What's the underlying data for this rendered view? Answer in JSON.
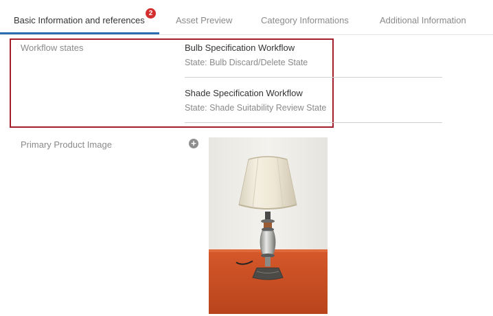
{
  "tabs": [
    {
      "label": "Basic Information and references",
      "active": true,
      "badge": "2"
    },
    {
      "label": "Asset Preview",
      "active": false
    },
    {
      "label": "Category Informations",
      "active": false
    },
    {
      "label": "Additional Information",
      "active": false
    }
  ],
  "workflow_section": {
    "label": "Workflow states",
    "workflows": [
      {
        "title": "Bulb Specification Workflow",
        "state": "State: Bulb Discard/Delete State"
      },
      {
        "title": "Shade Specification Workflow",
        "state": "State: Shade Suitability Review State"
      }
    ]
  },
  "primary_image": {
    "label": "Primary Product Image",
    "add_icon": "plus-circle-icon",
    "image_description": "table-lamp-photo"
  },
  "colors": {
    "accent": "#2b6cb0",
    "badge": "#d32f2f",
    "highlight": "#a21d2a"
  }
}
